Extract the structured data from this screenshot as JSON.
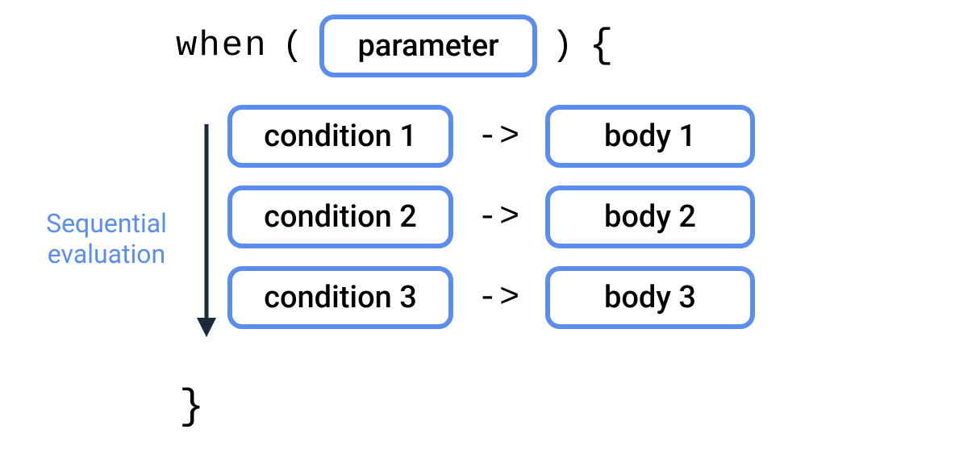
{
  "header": {
    "keyword": "when",
    "openParen": "(",
    "parameter": "parameter",
    "closeParen": ")",
    "openBrace": "{",
    "closeBrace": "}"
  },
  "rows": [
    {
      "condition": "condition 1",
      "arrow": "->",
      "body": "body 1"
    },
    {
      "condition": "condition 2",
      "arrow": "->",
      "body": "body 2"
    },
    {
      "condition": "condition 3",
      "arrow": "->",
      "body": "body 3"
    }
  ],
  "annotation": {
    "line1": "Sequential",
    "line2": "evaluation"
  }
}
